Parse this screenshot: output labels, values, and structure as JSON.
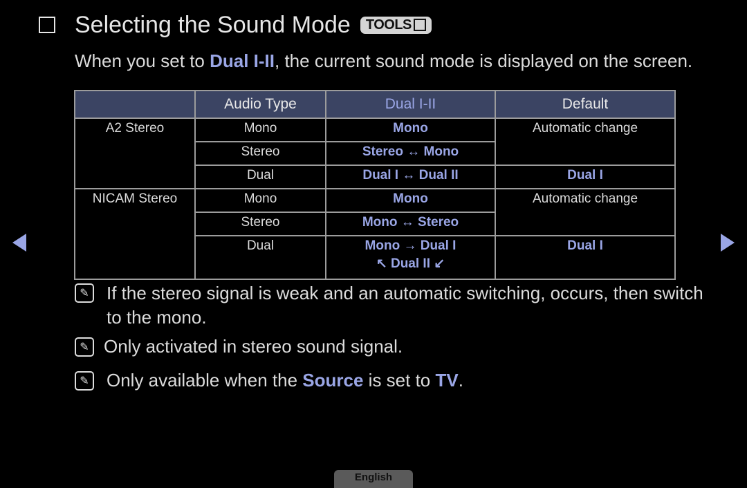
{
  "title": {
    "text": "Selecting the Sound Mode",
    "badge": "TOOLS"
  },
  "intro": {
    "pre": "When you set to ",
    "highlight": "Dual I-II",
    "post": ", the current sound mode is displayed on the screen."
  },
  "table": {
    "headers": [
      "",
      "Audio Type",
      "Dual I-II",
      "Default"
    ],
    "groups": [
      {
        "name": "A2 Stereo",
        "rows": [
          {
            "audio": "Mono",
            "dual": "Mono"
          },
          {
            "audio": "Stereo",
            "dual": "Stereo ↔ Mono"
          },
          {
            "audio": "Dual",
            "dual": "Dual I ↔ Dual II"
          }
        ],
        "default_auto": "Automatic change",
        "default_dual": "Dual I"
      },
      {
        "name": "NICAM Stereo",
        "rows": [
          {
            "audio": "Mono",
            "dual": "Mono"
          },
          {
            "audio": "Stereo",
            "dual": "Mono ↔ Stereo"
          },
          {
            "audio": "Dual",
            "dual": "Mono → Dual I",
            "dual2": "↖ Dual II ↙"
          }
        ],
        "default_auto": "Automatic change",
        "default_dual": "Dual I"
      }
    ]
  },
  "notes": [
    {
      "line1": "If the stereo signal is weak and an automatic switching, occurs, then switch",
      "line2": "to the mono."
    },
    {
      "text": "Only activated in stereo sound signal."
    },
    {
      "pre": "Only available when the ",
      "hl1": "Source",
      "mid": " is set to ",
      "hl2": "TV",
      "post": "."
    }
  ],
  "nav": {
    "prev": "previous-page",
    "next": "next-page"
  },
  "language": "English",
  "colors": {
    "accent": "#9aa6e6",
    "header_bg": "#3b4463"
  }
}
